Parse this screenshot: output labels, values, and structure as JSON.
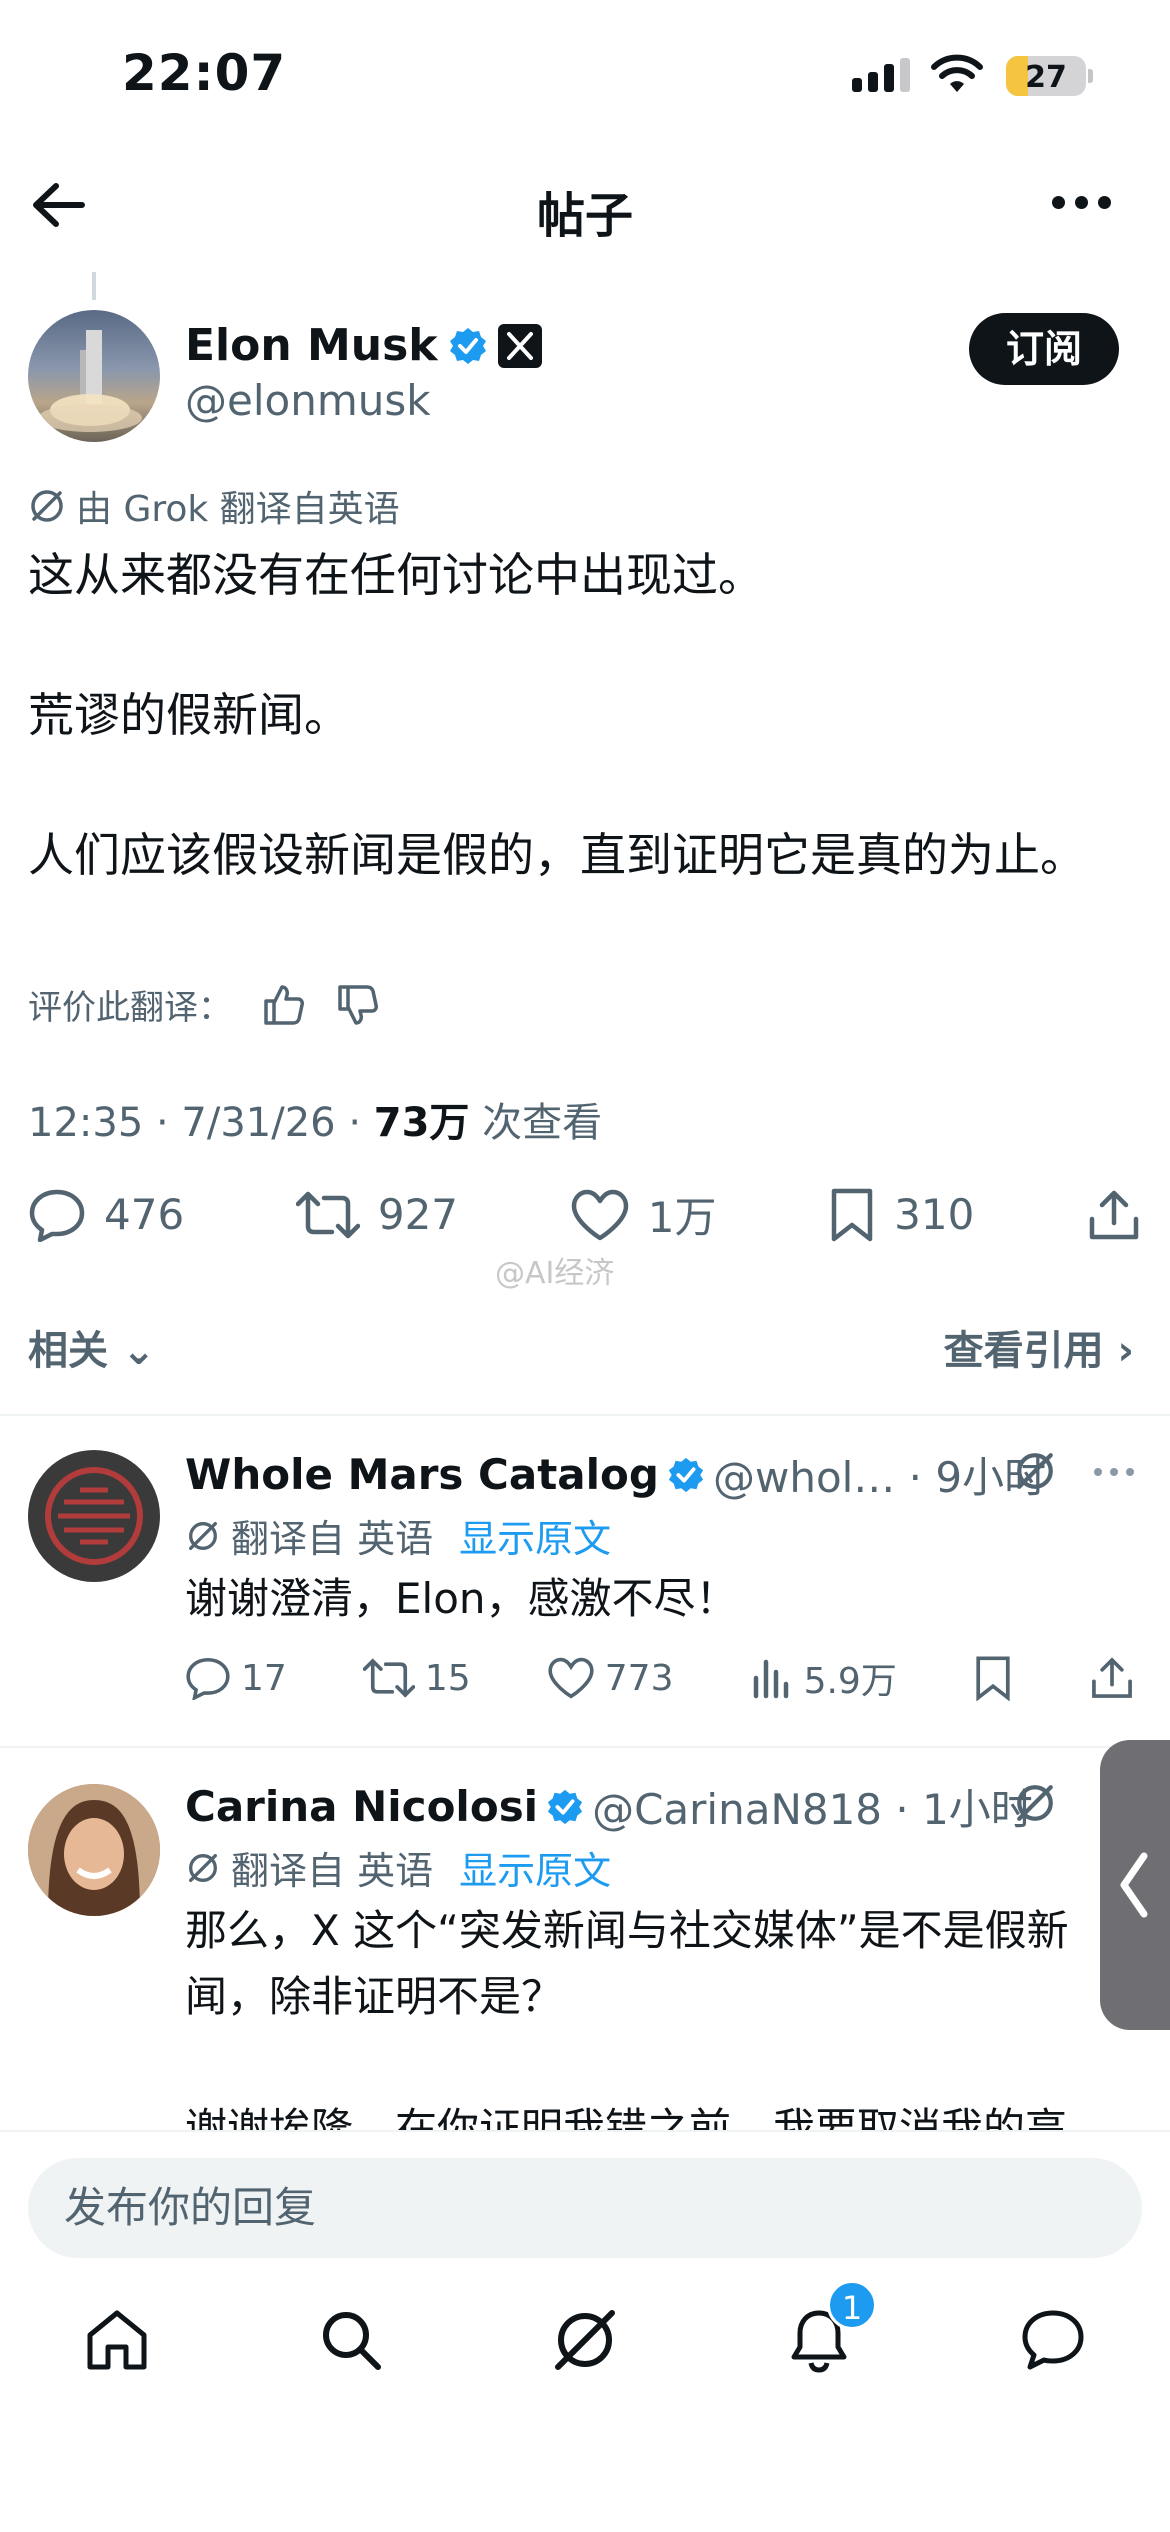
{
  "status_bar": {
    "time": "22:07",
    "battery": "27",
    "battery_level": 0.27
  },
  "header": {
    "title": "帖子"
  },
  "post": {
    "author_name": "Elon Musk",
    "author_handle": "@elonmusk",
    "subscribe_label": "订阅",
    "translated_note": "由 Grok 翻译自英语",
    "text": "这从来都没有在任何讨论中出现过。\n\n荒谬的假新闻。\n\n人们应该假设新闻是假的，直到证明它是真的为止。",
    "rate_label": "评价此翻译：",
    "timestamp": "12:35 · 7/31/26 · ",
    "views_count": "73万",
    "views_label": " 次查看",
    "stats": {
      "replies": "476",
      "reposts": "927",
      "likes": "1万",
      "bookmarks": "310"
    }
  },
  "watermark": "@AI经济",
  "related_label": "相关",
  "quotes_label": "查看引用",
  "replies": [
    {
      "name": "Whole Mars Catalog",
      "handle": "@whol… · 9小时",
      "translated": "翻译自 英语",
      "show_original": "显示原文",
      "text": "谢谢澄清，Elon，感激不尽！",
      "stats": {
        "replies": "17",
        "reposts": "15",
        "likes": "773",
        "views": "5.9万"
      }
    },
    {
      "name": "Carina Nicolosi",
      "handle": "@CarinaN818 · 1小时",
      "translated": "翻译自 英语",
      "show_original": "显示原文",
      "text": "那么，X 这个“突发新闻与社交媒体”是不是假新闻，除非证明不是？\n\n谢谢埃隆，在你证明我错之前，我要取消我的高"
    }
  ],
  "reply_placeholder": "发布你的回复",
  "nav": {
    "notification_count": "1"
  },
  "colors": {
    "accent": "#1d9bf0",
    "text": "#0f1419",
    "secondary": "#536471"
  }
}
